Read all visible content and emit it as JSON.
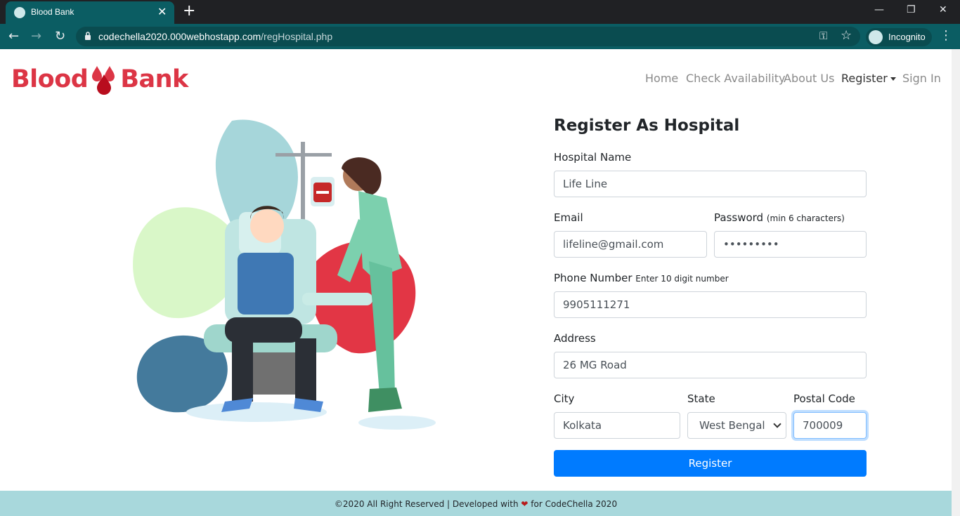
{
  "browser": {
    "tab_title": "Blood Bank",
    "tab_close": "✕",
    "new_tab": "+",
    "minimize": "—",
    "restore": "❐",
    "close": "✕",
    "url_host": "codechella2020.000webhostapp.com",
    "url_path": "/regHospital.php",
    "incognito_label": "Incognito",
    "back": "←",
    "forward": "→",
    "reload": "↻",
    "key_glyph": "⚿",
    "star_glyph": "☆",
    "menu_glyph": "⋮"
  },
  "brand": {
    "left": "Blood",
    "right": "Bank",
    "color": "#dc3545"
  },
  "nav": {
    "home": "Home",
    "check": "Check Availability",
    "about": "About Us",
    "register": "Register",
    "signin": "Sign In"
  },
  "form": {
    "title": "Register As Hospital",
    "hospital_name_label": "Hospital Name",
    "hospital_name_value": "Life Line",
    "email_label": "Email",
    "email_value": "lifeline@gmail.com",
    "password_label": "Password",
    "password_hint": "(min 6 characters)",
    "password_value": "•••••••••",
    "phone_label": "Phone Number",
    "phone_hint": "Enter 10 digit number",
    "phone_value": "9905111271",
    "address_label": "Address",
    "address_value": "26 MG Road",
    "city_label": "City",
    "city_value": "Kolkata",
    "state_label": "State",
    "state_value": "West Bengal",
    "postal_label": "Postal Code",
    "postal_value": "700009",
    "submit": "Register",
    "button_color": "#007bff"
  },
  "footer": {
    "left": "©2020 All Right Reserved | Developed with",
    "heart": "❤",
    "right": "for CodeChella 2020",
    "bg": "#a8d8dc"
  }
}
